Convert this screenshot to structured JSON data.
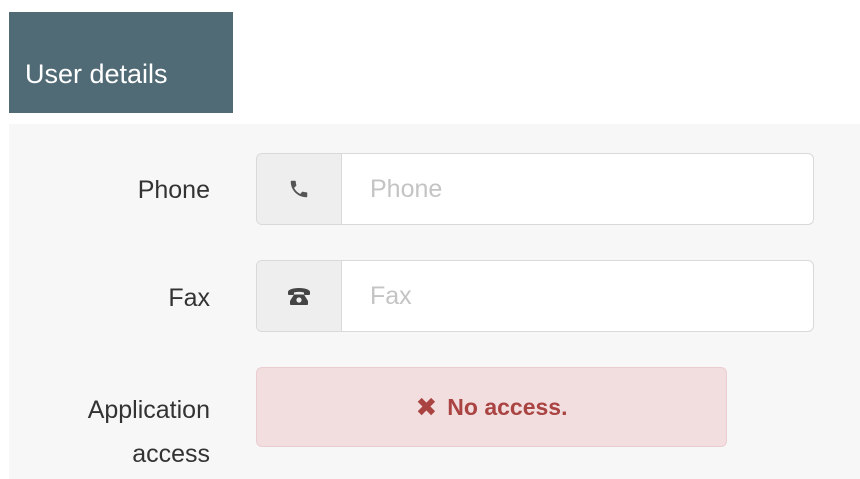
{
  "header": {
    "title": "User details",
    "background_color": "#506a76"
  },
  "form": {
    "phone": {
      "label": "Phone",
      "placeholder": "Phone",
      "value": "",
      "icon": "phone-handset-icon"
    },
    "fax": {
      "label": "Fax",
      "placeholder": "Fax",
      "value": "",
      "icon": "fax-phone-icon"
    },
    "application_access": {
      "label_line1": "Application",
      "label_line2": "access",
      "status_icon": "times-icon",
      "status_text": "No access.",
      "status_color": "#a94442",
      "status_background": "#f2dede"
    }
  }
}
